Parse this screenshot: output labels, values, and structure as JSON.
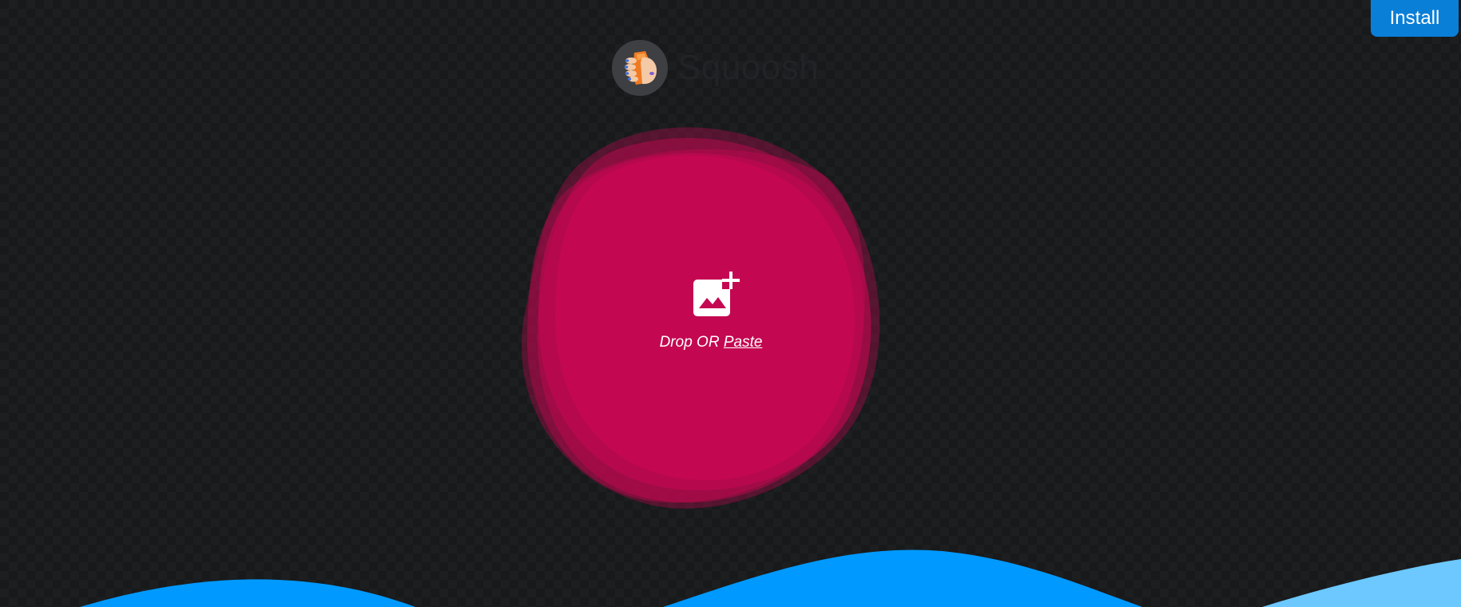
{
  "header": {
    "install_label": "Install",
    "app_name": "Squoosh"
  },
  "drop_zone": {
    "drop_or_label": "Drop OR ",
    "paste_label": "Paste"
  },
  "icons": {
    "logo": "squoosh-hand-logo-icon",
    "add_image": "add-image-icon"
  },
  "colors": {
    "background": "#18191b",
    "blob": "#c50852",
    "install_button": "#0a7fd8",
    "wave_primary": "#0099ff",
    "wave_light": "#6cc8ff"
  }
}
